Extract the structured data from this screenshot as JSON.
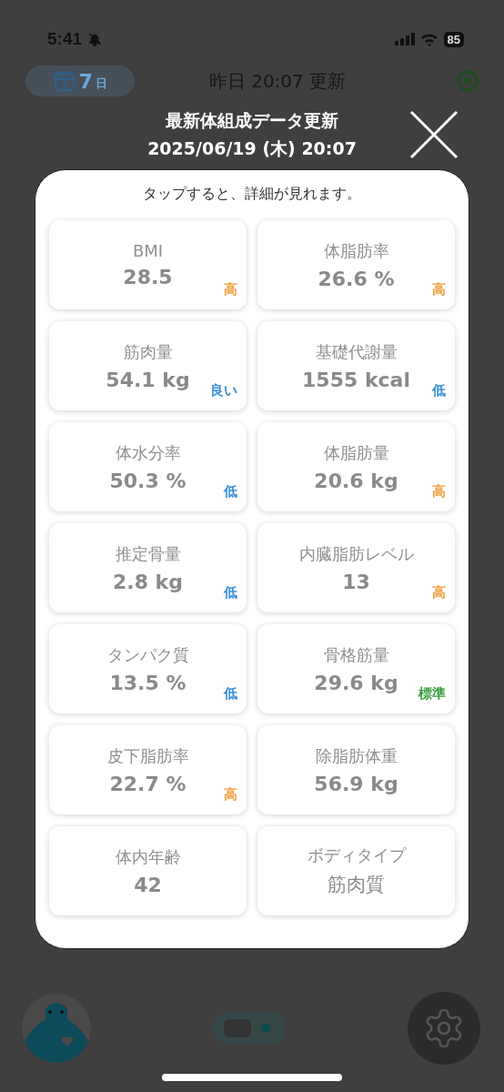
{
  "status_bar": {
    "time": "5:41",
    "battery": "85"
  },
  "header": {
    "days": "7",
    "days_unit": "日",
    "updated": "昨日 20:07 更新"
  },
  "modal": {
    "title": "最新体組成データ更新",
    "date": "2025/06/19 (木) 20:07",
    "hint": "タップすると、詳細が見れます。",
    "metrics": [
      {
        "kind": "measure",
        "label": "BMI",
        "value": "28.5",
        "status": "高",
        "color": "#f0a040"
      },
      {
        "kind": "measure",
        "label": "体脂肪率",
        "value": "26.6 %",
        "status": "高",
        "color": "#f0a040"
      },
      {
        "kind": "measure",
        "label": "筋肉量",
        "value": "54.1 kg",
        "status": "良い",
        "color": "#3a8fd8"
      },
      {
        "kind": "measure",
        "label": "基礎代謝量",
        "value": "1555 kcal",
        "status": "低",
        "color": "#3a8fd8"
      },
      {
        "kind": "measure",
        "label": "体水分率",
        "value": "50.3 %",
        "status": "低",
        "color": "#3a8fd8"
      },
      {
        "kind": "measure",
        "label": "体脂肪量",
        "value": "20.6 kg",
        "status": "高",
        "color": "#f0a040"
      },
      {
        "kind": "measure",
        "label": "推定骨量",
        "value": "2.8 kg",
        "status": "低",
        "color": "#3a8fd8"
      },
      {
        "kind": "measure",
        "label": "内臓脂肪レベル",
        "value": "13",
        "status": "高",
        "color": "#f0a040"
      },
      {
        "kind": "measure",
        "label": "タンパク質",
        "value": "13.5 %",
        "status": "低",
        "color": "#3a8fd8"
      },
      {
        "kind": "measure",
        "label": "骨格筋量",
        "value": "29.6 kg",
        "status": "標準",
        "color": "#3aa040"
      },
      {
        "kind": "measure",
        "label": "皮下脂肪率",
        "value": "22.7 %",
        "status": "高",
        "color": "#f0a040"
      },
      {
        "kind": "measure",
        "label": "除脂肪体重",
        "value": "56.9 kg"
      },
      {
        "kind": "measure",
        "label": "体内年齢",
        "value": "42"
      },
      {
        "kind": "type",
        "label": "ボディタイプ",
        "value": "筋肉質"
      }
    ]
  }
}
